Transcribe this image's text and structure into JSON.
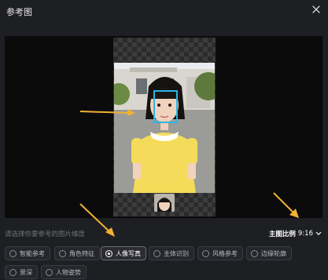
{
  "dialog": {
    "title": "参考图"
  },
  "hint": "请选择你要参考的图片维度",
  "ratio": {
    "label": "主图比例",
    "value": "9:16"
  },
  "options": [
    {
      "label": "智能参考",
      "selected": false
    },
    {
      "label": "角色特征",
      "selected": false
    },
    {
      "label": "人像写真",
      "selected": true
    },
    {
      "label": "主体识别",
      "selected": false
    },
    {
      "label": "风格参考",
      "selected": false
    },
    {
      "label": "边缘轮廓",
      "selected": false
    },
    {
      "label": "景深",
      "selected": false
    },
    {
      "label": "人物姿势",
      "selected": false
    }
  ],
  "icons": {
    "close": "close-icon",
    "chevron": "chevron-down-icon",
    "radio": "radio-icon",
    "arrow": "arrow-annotation-icon"
  },
  "colors": {
    "background": "#1e1f23",
    "face_box": "#29b6e6",
    "annotation_arrow": "#f2b233",
    "dress": "#f4dc5a"
  }
}
